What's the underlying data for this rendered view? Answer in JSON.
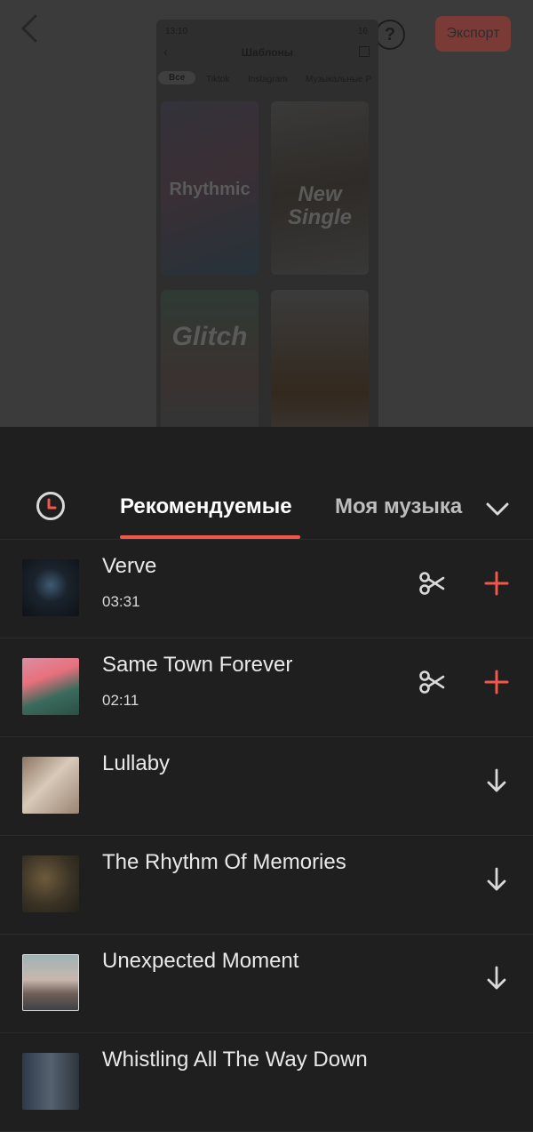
{
  "header": {
    "export_label": "Экспорт",
    "help_label": "?"
  },
  "preview": {
    "status_time": "13:10",
    "status_battery": "16",
    "title": "Шаблоны",
    "tabs": [
      "Все",
      "Tiktok",
      "Instagram",
      "Музыкальные Р"
    ],
    "templates": [
      "Rhythmic",
      "New Single",
      "Glitch",
      ""
    ]
  },
  "music_sheet": {
    "tabs": {
      "recommended": "Рекомендуемые",
      "my_music": "Моя музыка"
    },
    "tracks": [
      {
        "title": "Verve",
        "duration": "03:31",
        "action": "add"
      },
      {
        "title": "Same Town Forever",
        "duration": "02:11",
        "action": "add"
      },
      {
        "title": "Lullaby",
        "duration": "",
        "action": "download"
      },
      {
        "title": "The Rhythm Of Memories",
        "duration": "",
        "action": "download"
      },
      {
        "title": "Unexpected Moment",
        "duration": "",
        "action": "download"
      },
      {
        "title": "Whistling All The Way Down",
        "duration": "",
        "action": "download"
      }
    ]
  },
  "colors": {
    "accent": "#f1574a",
    "sheet_bg": "#1f1f1f",
    "dim_bg": "#3b3b3b"
  }
}
